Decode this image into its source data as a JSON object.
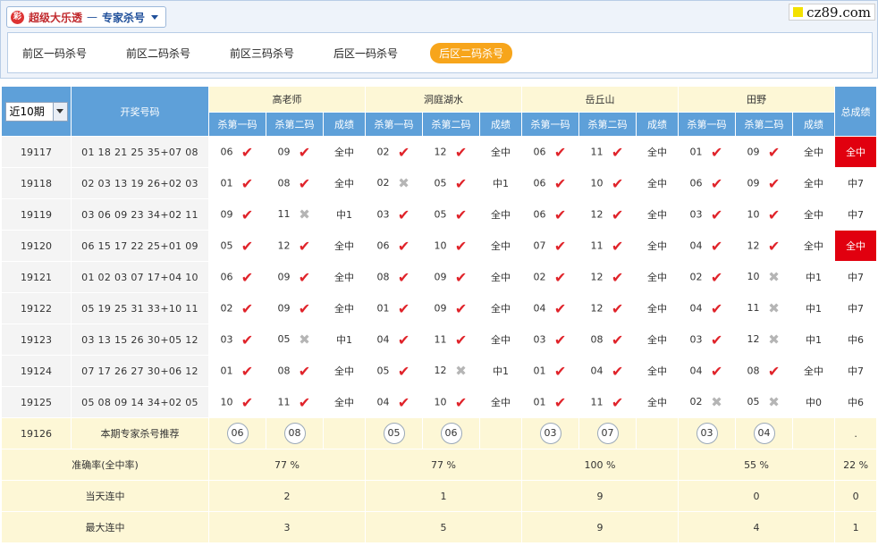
{
  "header": {
    "logo_char": "彩",
    "title": "超级大乐透",
    "separator": "—",
    "subtitle": "专家杀号",
    "brand": "cz89.com"
  },
  "tabs": [
    {
      "label": "前区一码杀号",
      "active": false
    },
    {
      "label": "前区二码杀号",
      "active": false
    },
    {
      "label": "前区三码杀号",
      "active": false
    },
    {
      "label": "后区一码杀号",
      "active": false
    },
    {
      "label": "后区二码杀号",
      "active": true
    }
  ],
  "table": {
    "period_select": "近10期",
    "draw_header": "开奖号码",
    "total_header": "总成绩",
    "sub_headers": [
      "杀第一码",
      "杀第二码",
      "成绩"
    ],
    "experts": [
      "高老师",
      "洞庭湖水",
      "岳丘山",
      "田野"
    ],
    "rows": [
      {
        "issue": "19117",
        "nums": "01 18 21 25 35+07 08",
        "e": [
          [
            "06",
            "ok",
            "09",
            "ok",
            "全中"
          ],
          [
            "02",
            "ok",
            "12",
            "ok",
            "全中"
          ],
          [
            "06",
            "ok",
            "11",
            "ok",
            "全中"
          ],
          [
            "01",
            "ok",
            "09",
            "ok",
            "全中"
          ]
        ],
        "total": "全中"
      },
      {
        "issue": "19118",
        "nums": "02 03 13 19 26+02 03",
        "e": [
          [
            "01",
            "ok",
            "08",
            "ok",
            "全中"
          ],
          [
            "02",
            "bad",
            "05",
            "ok",
            "中1"
          ],
          [
            "06",
            "ok",
            "10",
            "ok",
            "全中"
          ],
          [
            "06",
            "ok",
            "09",
            "ok",
            "全中"
          ]
        ],
        "total": "中7"
      },
      {
        "issue": "19119",
        "nums": "03 06 09 23 34+02 11",
        "e": [
          [
            "09",
            "ok",
            "11",
            "bad",
            "中1"
          ],
          [
            "03",
            "ok",
            "05",
            "ok",
            "全中"
          ],
          [
            "06",
            "ok",
            "12",
            "ok",
            "全中"
          ],
          [
            "03",
            "ok",
            "10",
            "ok",
            "全中"
          ]
        ],
        "total": "中7"
      },
      {
        "issue": "19120",
        "nums": "06 15 17 22 25+01 09",
        "e": [
          [
            "05",
            "ok",
            "12",
            "ok",
            "全中"
          ],
          [
            "06",
            "ok",
            "10",
            "ok",
            "全中"
          ],
          [
            "07",
            "ok",
            "11",
            "ok",
            "全中"
          ],
          [
            "04",
            "ok",
            "12",
            "ok",
            "全中"
          ]
        ],
        "total": "全中"
      },
      {
        "issue": "19121",
        "nums": "01 02 03 07 17+04 10",
        "e": [
          [
            "06",
            "ok",
            "09",
            "ok",
            "全中"
          ],
          [
            "08",
            "ok",
            "09",
            "ok",
            "全中"
          ],
          [
            "02",
            "ok",
            "12",
            "ok",
            "全中"
          ],
          [
            "02",
            "ok",
            "10",
            "bad",
            "中1"
          ]
        ],
        "total": "中7"
      },
      {
        "issue": "19122",
        "nums": "05 19 25 31 33+10 11",
        "e": [
          [
            "02",
            "ok",
            "09",
            "ok",
            "全中"
          ],
          [
            "01",
            "ok",
            "09",
            "ok",
            "全中"
          ],
          [
            "04",
            "ok",
            "12",
            "ok",
            "全中"
          ],
          [
            "04",
            "ok",
            "11",
            "bad",
            "中1"
          ]
        ],
        "total": "中7"
      },
      {
        "issue": "19123",
        "nums": "03 13 15 26 30+05 12",
        "e": [
          [
            "03",
            "ok",
            "05",
            "bad",
            "中1"
          ],
          [
            "04",
            "ok",
            "11",
            "ok",
            "全中"
          ],
          [
            "03",
            "ok",
            "08",
            "ok",
            "全中"
          ],
          [
            "03",
            "ok",
            "12",
            "bad",
            "中1"
          ]
        ],
        "total": "中6"
      },
      {
        "issue": "19124",
        "nums": "07 17 26 27 30+06 12",
        "e": [
          [
            "01",
            "ok",
            "08",
            "ok",
            "全中"
          ],
          [
            "05",
            "ok",
            "12",
            "bad",
            "中1"
          ],
          [
            "01",
            "ok",
            "04",
            "ok",
            "全中"
          ],
          [
            "04",
            "ok",
            "08",
            "ok",
            "全中"
          ]
        ],
        "total": "中7"
      },
      {
        "issue": "19125",
        "nums": "05 08 09 14 34+02 05",
        "e": [
          [
            "10",
            "ok",
            "11",
            "ok",
            "全中"
          ],
          [
            "04",
            "ok",
            "10",
            "ok",
            "全中"
          ],
          [
            "01",
            "ok",
            "11",
            "ok",
            "全中"
          ],
          [
            "02",
            "bad",
            "05",
            "bad",
            "中0"
          ]
        ],
        "total": "中6"
      }
    ],
    "recommend": {
      "issue": "19126",
      "label": "本期专家杀号推荐",
      "picks": [
        [
          "06",
          "08"
        ],
        [
          "05",
          "06"
        ],
        [
          "03",
          "07"
        ],
        [
          "03",
          "04"
        ]
      ],
      "total": "."
    },
    "stats": [
      {
        "label": "准确率(全中率)",
        "values": [
          "77 %",
          "77 %",
          "100 %",
          "55 %"
        ],
        "total": "22 %"
      },
      {
        "label": "当天连中",
        "values": [
          "2",
          "1",
          "9",
          "0"
        ],
        "total": "0"
      },
      {
        "label": "最大连中",
        "values": [
          "3",
          "5",
          "9",
          "4"
        ],
        "total": "1"
      }
    ]
  }
}
